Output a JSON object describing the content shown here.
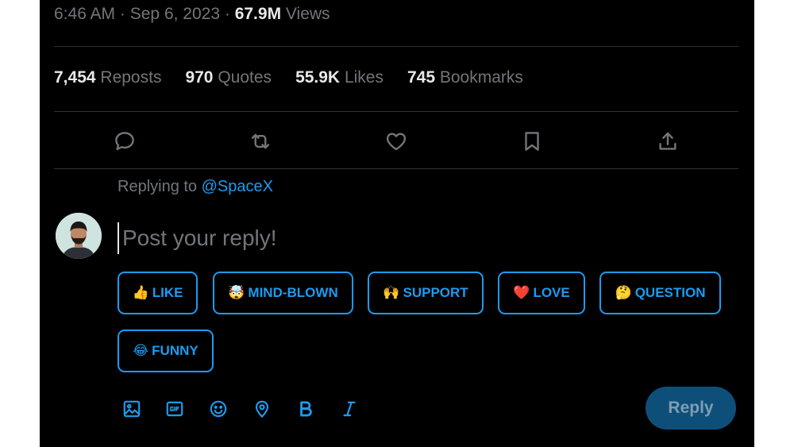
{
  "post": {
    "time": "6:46 AM",
    "separator": "·",
    "date": "Sep 6, 2023",
    "views_count": "67.9M",
    "views_label": "Views"
  },
  "stats": [
    {
      "count": "7,454",
      "label": "Reposts"
    },
    {
      "count": "970",
      "label": "Quotes"
    },
    {
      "count": "55.9K",
      "label": "Likes"
    },
    {
      "count": "745",
      "label": "Bookmarks"
    }
  ],
  "actions": [
    "reply-icon",
    "repost-icon",
    "like-icon",
    "bookmark-icon",
    "share-icon"
  ],
  "reply": {
    "replying_to_label": "Replying to",
    "handle": "@SpaceX",
    "placeholder": "Post your reply!",
    "button_label": "Reply"
  },
  "reactions": [
    {
      "emoji": "👍",
      "label": "LIKE"
    },
    {
      "emoji": "🤯",
      "label": "MIND-BLOWN"
    },
    {
      "emoji": "🙌",
      "label": "SUPPORT"
    },
    {
      "emoji": "❤️",
      "label": "LOVE"
    },
    {
      "emoji": "🤔",
      "label": "QUESTION"
    },
    {
      "emoji": "😂",
      "label": "FUNNY"
    }
  ],
  "toolbar": [
    "image-icon",
    "gif-icon",
    "emoji-icon",
    "location-icon",
    "bold-icon",
    "italic-icon"
  ],
  "colors": {
    "background": "#000000",
    "accent": "#1d9bf0",
    "muted_text": "#71767b",
    "primary_text": "#e7e9ea",
    "reply_button": "#0e4f7a"
  }
}
